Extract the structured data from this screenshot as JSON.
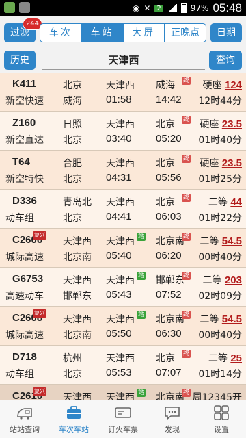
{
  "status_bar": {
    "battery": "97%",
    "time": "05:48",
    "badge": "2"
  },
  "toolbar": {
    "filter_label": "过滤",
    "filter_count": "244",
    "date_label": "日期",
    "tabs": [
      {
        "label": "车次",
        "active": false
      },
      {
        "label": "车站",
        "active": true
      },
      {
        "label": "大屏",
        "active": false
      },
      {
        "label": "正晚点",
        "active": false
      }
    ]
  },
  "search": {
    "history_label": "历史",
    "station_value": "天津西",
    "query_label": "查询"
  },
  "trains": [
    {
      "code": "K411",
      "type": "新空快速",
      "from": "北京",
      "to": "威海",
      "station": "天津西",
      "dep": "01:58",
      "dest": "威海",
      "arr": "14:42",
      "seat": "硬座",
      "price": "124",
      "duration": "12时44分",
      "tag_end": "终"
    },
    {
      "code": "Z160",
      "type": "新空直达",
      "from": "日照",
      "to": "北京",
      "station": "天津西",
      "dep": "03:40",
      "dest": "北京",
      "arr": "05:20",
      "seat": "硬座",
      "price": "23.5",
      "duration": "01时40分",
      "tag_end": "终"
    },
    {
      "code": "T64",
      "type": "新空特快",
      "from": "合肥",
      "to": "北京",
      "station": "天津西",
      "dep": "04:31",
      "dest": "北京",
      "arr": "05:56",
      "seat": "硬座",
      "price": "23.5",
      "duration": "01时25分",
      "tag_end": "终"
    },
    {
      "code": "D336",
      "type": "动车组",
      "from": "青岛北",
      "to": "北京",
      "station": "天津西",
      "dep": "04:41",
      "dest": "北京",
      "arr": "06:03",
      "seat": "二等",
      "price": "44",
      "duration": "01时22分",
      "tag_end": "终"
    },
    {
      "code": "C2606",
      "type": "城际高速",
      "from": "天津西",
      "to": "北京南",
      "station": "天津西",
      "dep": "05:40",
      "dest": "北京南",
      "arr": "06:20",
      "seat": "二等",
      "price": "54.5",
      "duration": "00时40分",
      "tag_end": "终",
      "tag_fx": "复兴",
      "tag_stn": "站"
    },
    {
      "code": "G6753",
      "type": "高速动车",
      "from": "天津西",
      "to": "邯郸东",
      "station": "天津西",
      "dep": "05:43",
      "dest": "邯郸东",
      "arr": "07:52",
      "seat": "二等",
      "price": "203",
      "duration": "02时09分",
      "tag_end": "终",
      "tag_stn": "站"
    },
    {
      "code": "C2608",
      "type": "城际高速",
      "from": "天津西",
      "to": "北京南",
      "station": "天津西",
      "dep": "05:50",
      "dest": "北京南",
      "arr": "06:30",
      "seat": "二等",
      "price": "54.5",
      "duration": "00时40分",
      "tag_end": "终",
      "tag_fx": "复兴",
      "tag_stn": "站"
    },
    {
      "code": "D718",
      "type": "动车组",
      "from": "杭州",
      "to": "北京",
      "station": "天津西",
      "dep": "05:53",
      "dest": "北京",
      "arr": "07:07",
      "seat": "二等",
      "price": "25",
      "duration": "01时14分",
      "tag_end": "终"
    }
  ],
  "partial_row": {
    "code": "C2610",
    "from": "天津西",
    "station": "天津西",
    "dest": "北京南",
    "schedule": "周12345开",
    "tag_fx": "复兴",
    "tag_stn": "站",
    "tag_end": "终"
  },
  "bottom_nav": [
    {
      "label": "站站查询",
      "icon": "train-icon",
      "active": false
    },
    {
      "label": "车次车站",
      "icon": "briefcase-icon",
      "active": true
    },
    {
      "label": "订火车票",
      "icon": "ticket-icon",
      "active": false
    },
    {
      "label": "发现",
      "icon": "chat-icon",
      "active": false
    },
    {
      "label": "设置",
      "icon": "grid-icon",
      "active": false
    }
  ]
}
